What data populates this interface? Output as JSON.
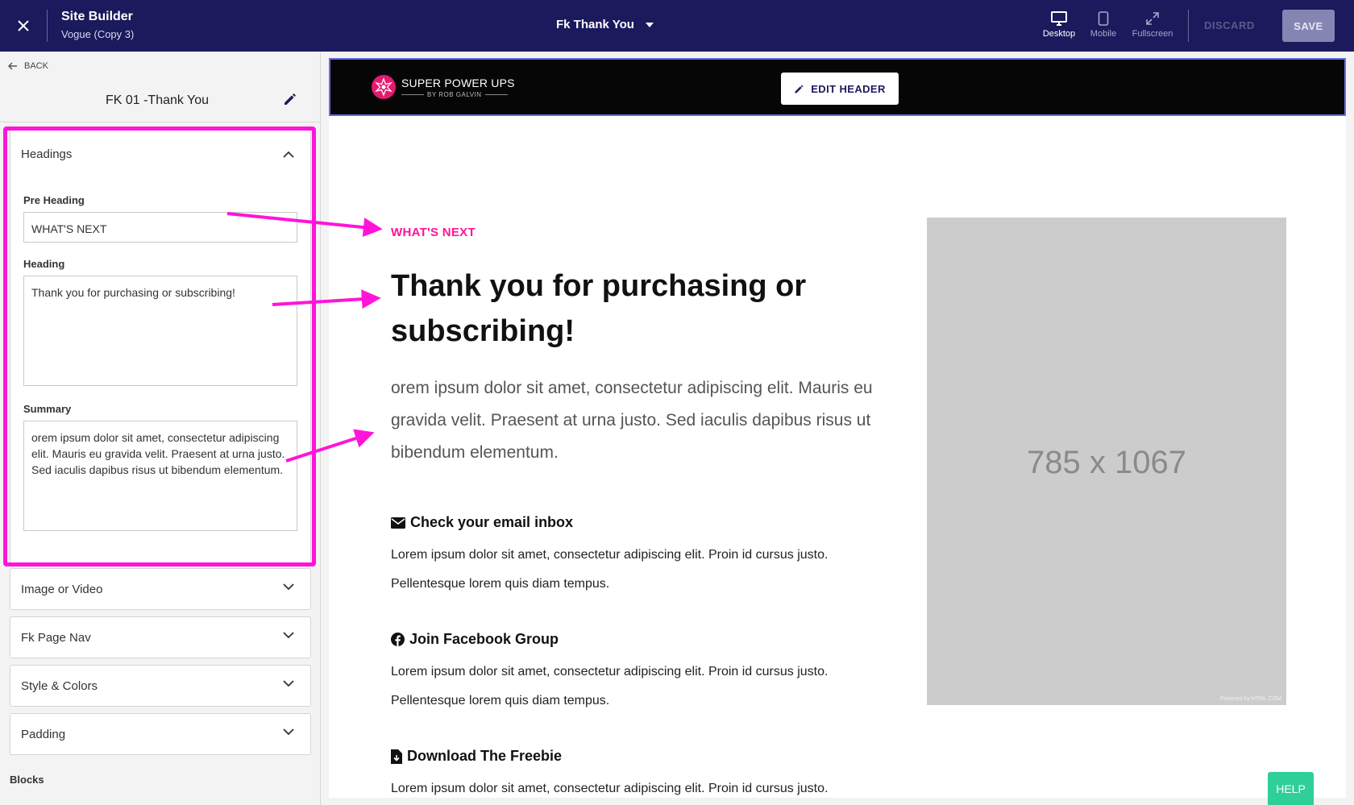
{
  "topbar": {
    "title": "Site Builder",
    "subtitle": "Vogue (Copy 3)",
    "page_selector": "Fk Thank You",
    "views": {
      "desktop": "Desktop",
      "mobile": "Mobile",
      "fullscreen": "Fullscreen"
    },
    "discard": "DISCARD",
    "save": "SAVE"
  },
  "sidebar": {
    "back": "BACK",
    "page_name": "FK 01 -Thank You",
    "headings": {
      "title": "Headings",
      "pre_heading_label": "Pre Heading",
      "pre_heading_value": "WHAT'S NEXT",
      "heading_label": "Heading",
      "heading_value": "Thank you for purchasing or subscribing!",
      "summary_label": "Summary",
      "summary_value": "orem ipsum dolor sit amet, consectetur adipiscing elit. Mauris eu gravida velit. Praesent at urna justo. Sed iaculis dapibus risus ut bibendum elementum."
    },
    "sections": [
      "Image or Video",
      "Fk Page Nav",
      "Style & Colors",
      "Padding"
    ],
    "blocks_label": "Blocks"
  },
  "preview": {
    "logo_main": "SUPER POWER UPS",
    "logo_sub": "BY ROB GALVIN",
    "edit_header": "EDIT HEADER",
    "pre_heading": "WHAT'S NEXT",
    "heading": "Thank you for purchasing or subscribing!",
    "summary": "orem ipsum dolor sit amet, consectetur adipiscing elit. Mauris eu gravida velit. Praesent at urna justo. Sed iaculis dapibus risus ut bibendum elementum.",
    "items": [
      {
        "icon": "envelope-icon",
        "title": "Check your email inbox",
        "body": "Lorem ipsum dolor sit amet, consectetur adipiscing elit. Proin id cursus justo. Pellentesque lorem quis diam tempus."
      },
      {
        "icon": "facebook-icon",
        "title": "Join Facebook Group",
        "body": "Lorem ipsum dolor sit amet, consectetur adipiscing elit. Proin id cursus justo. Pellentesque lorem quis diam tempus."
      },
      {
        "icon": "file-download-icon",
        "title": "Download The Freebie",
        "body": "Lorem ipsum dolor sit amet, consectetur adipiscing elit. Proin id cursus justo."
      }
    ],
    "image_placeholder": "785 x 1067",
    "image_powered": "Powered by HTML.COM"
  },
  "help": "HELP",
  "colors": {
    "topbar": "#1b1a5c",
    "highlight": "#ff14d8",
    "pre_heading": "#ff1499",
    "help": "#2fcf9a"
  }
}
